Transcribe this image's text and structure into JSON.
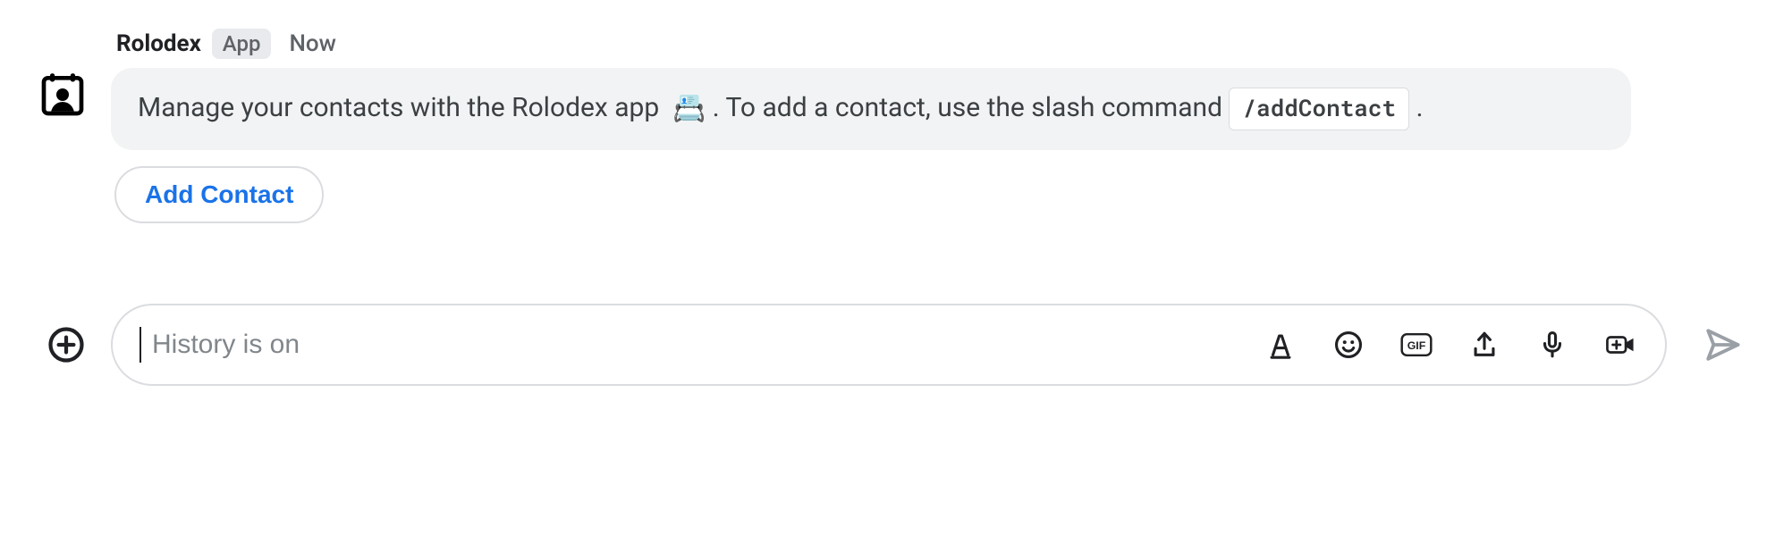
{
  "message": {
    "sender": "Rolodex",
    "sender_badge": "App",
    "time": "Now",
    "text_part1": "Manage your contacts with the Rolodex app",
    "text_part2": ". To add a contact, use the slash command ",
    "command_text": "/addContact",
    "text_part3": ".",
    "rolodex_emoji_name": "card-index-emoji"
  },
  "actions": {
    "add_contact_label": "Add Contact"
  },
  "composer": {
    "placeholder": "History is on",
    "plus_button_label": "Attach / add",
    "send_label": "Send",
    "icon_names": {
      "format": "text-format",
      "emoji": "emoji",
      "gif": "gif",
      "upload": "upload",
      "mic": "microphone",
      "video": "add-video"
    }
  }
}
